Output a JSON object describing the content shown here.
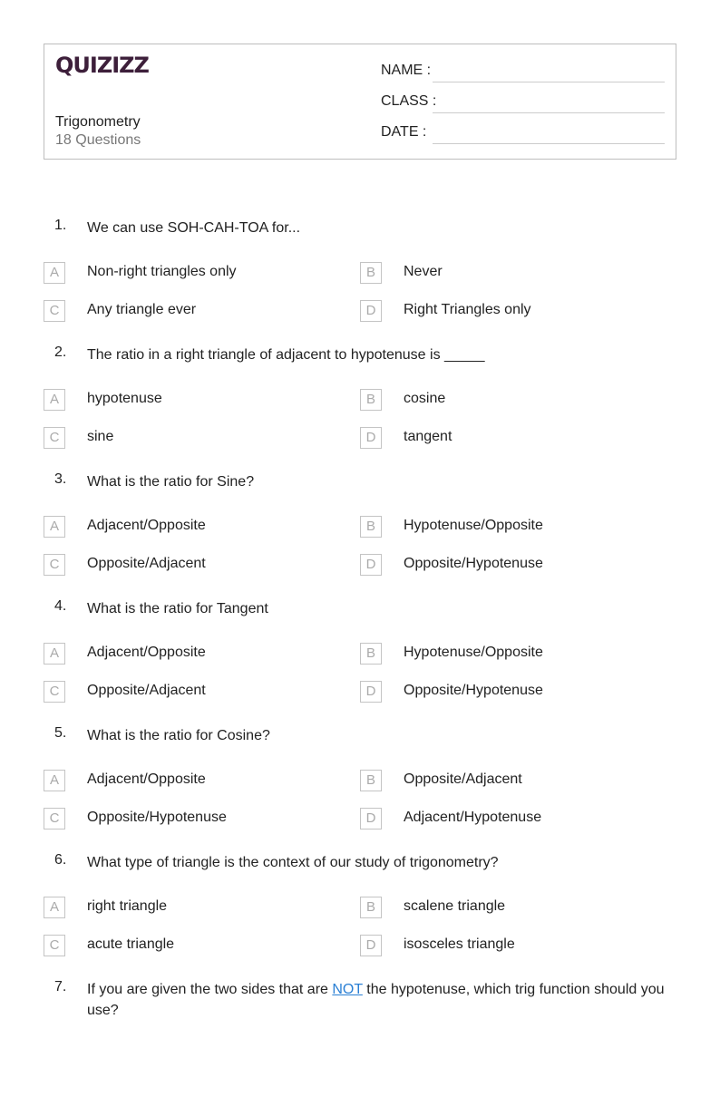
{
  "header": {
    "logo": "QUIZIZZ",
    "title": "Trigonometry",
    "question_count": "18 Questions",
    "fields": [
      "NAME :",
      "CLASS :",
      "DATE  :"
    ]
  },
  "questions": [
    {
      "num": "1.",
      "text": "We can use SOH-CAH-TOA for...",
      "options": [
        [
          "A",
          "Non-right triangles only"
        ],
        [
          "B",
          "Never"
        ],
        [
          "C",
          "Any triangle ever"
        ],
        [
          "D",
          "Right Triangles only"
        ]
      ]
    },
    {
      "num": "2.",
      "text": "The ratio in a right triangle of adjacent to hypotenuse is _____",
      "options": [
        [
          "A",
          "hypotenuse"
        ],
        [
          "B",
          "cosine"
        ],
        [
          "C",
          "sine"
        ],
        [
          "D",
          "tangent"
        ]
      ]
    },
    {
      "num": "3.",
      "text": "What is the ratio for Sine?",
      "options": [
        [
          "A",
          "Adjacent/Opposite"
        ],
        [
          "B",
          "Hypotenuse/Opposite"
        ],
        [
          "C",
          "Opposite/Adjacent"
        ],
        [
          "D",
          "Opposite/Hypotenuse"
        ]
      ]
    },
    {
      "num": "4.",
      "text": "What is the ratio for Tangent",
      "options": [
        [
          "A",
          "Adjacent/Opposite"
        ],
        [
          "B",
          "Hypotenuse/Opposite"
        ],
        [
          "C",
          "Opposite/Adjacent"
        ],
        [
          "D",
          "Opposite/Hypotenuse"
        ]
      ]
    },
    {
      "num": "5.",
      "text": "What is the ratio for Cosine?",
      "options": [
        [
          "A",
          "Adjacent/Opposite"
        ],
        [
          "B",
          "Opposite/Adjacent"
        ],
        [
          "C",
          "Opposite/Hypotenuse"
        ],
        [
          "D",
          "Adjacent/Hypotenuse"
        ]
      ]
    },
    {
      "num": "6.",
      "text": "What type of triangle is the context of our study of trigonometry?",
      "options": [
        [
          "A",
          "right triangle"
        ],
        [
          "B",
          "scalene triangle"
        ],
        [
          "C",
          "acute triangle"
        ],
        [
          "D",
          "isosceles triangle"
        ]
      ]
    },
    {
      "num": "7.",
      "text_before": "If you are given the two sides that are ",
      "text_link": "NOT",
      "text_after": " the hypotenuse, which trig function should you use?",
      "options": []
    }
  ]
}
